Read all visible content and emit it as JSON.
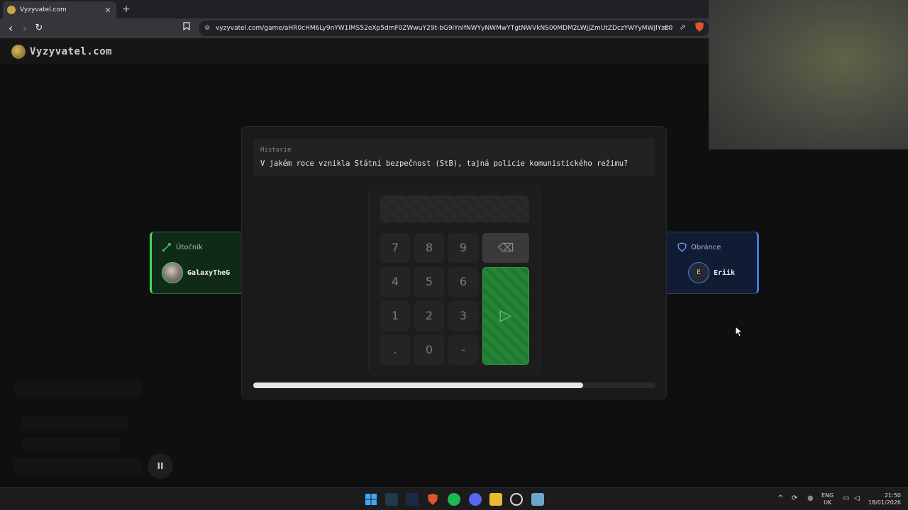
{
  "browser": {
    "tab_title": "Vyzyvatel.com",
    "tab_close": "✕",
    "new_tab": "+",
    "back": "‹",
    "forward": "›",
    "reload": "↻",
    "bookmark_icon": "bookmark-icon",
    "url": "vyzyvatel.com/game/aHR0cHM6Ly9nYW1lMS52eXp5dmF0ZWwuY29t-bG9iYnlfNWYyNWMwYTgtNWVkNS00MDM2LWJjZmUtZDczYWYyMWJlYzE0"
  },
  "site": {
    "logo_text": "Vyzyvatel.com"
  },
  "question": {
    "category": "Historie",
    "text": "V jakém roce vznikla Státní bezpečnost (StB), tajná policie komunistického režimu?"
  },
  "keypad": {
    "display_value": "",
    "keys": [
      "7",
      "8",
      "9",
      "4",
      "5",
      "6",
      "1",
      "2",
      "3",
      ".",
      "0",
      "-"
    ],
    "backspace_icon": "⌫",
    "submit_icon": "▷"
  },
  "progress": {
    "remaining_fraction": 0.82
  },
  "attacker": {
    "role": "Útočník",
    "player": "GalaxyTheG",
    "color": "#4cd35e"
  },
  "defender": {
    "role": "Obránce",
    "player": "Eriik",
    "initial": "E",
    "color": "#3d7be0"
  },
  "controls": {
    "pause_label": "II"
  },
  "taskbar": {
    "lang_top": "ENG",
    "lang_bottom": "UK",
    "time": "21:50",
    "date": "18/01/2026",
    "tray_chevron": "^"
  }
}
